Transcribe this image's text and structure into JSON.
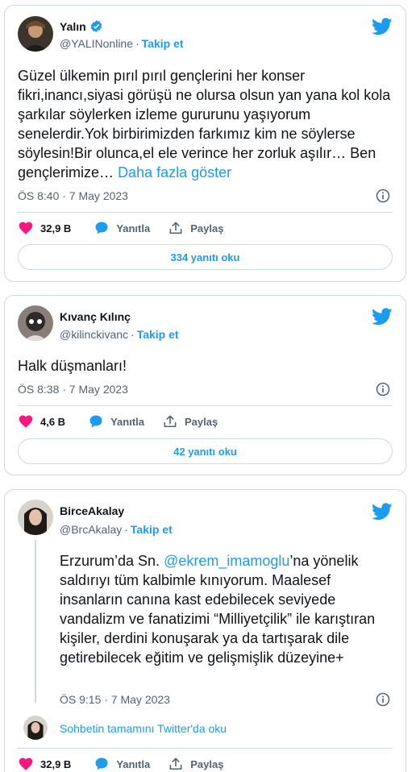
{
  "tweets": [
    {
      "name": "Yalın",
      "verified": true,
      "handle": "@YALINonline",
      "follow": "Takip et",
      "text": "Güzel ülkemin pırıl pırıl gençlerini her konser fikri,inancı,siyasi görüşü ne olursa olsun yan yana kol kola şarkılar söylerken izleme gururunu yaşıyorum senelerdir.Yok birbirimizden farkımız kim ne söylerse söylesin!Bir olunca,el ele verince her zorluk aşılır… Ben gençlerimize…",
      "more": "Daha fazla göster",
      "timestamp": "ÖS 8:40 · 7 May 2023",
      "likes": "32,9 B",
      "reply": "Yanıtla",
      "share": "Paylaş",
      "replies_button": "334 yanıtı oku"
    },
    {
      "name": "Kıvanç Kılınç",
      "handle": "@kilinckivanc",
      "follow": "Takip et",
      "text": "Halk düşmanları!",
      "timestamp": "ÖS 8:38 · 7 May 2023",
      "likes": "4,6 B",
      "reply": "Yanıtla",
      "share": "Paylaş",
      "replies_button": "42 yanıtı oku"
    },
    {
      "name": "BirceAkalay",
      "handle": "@BrcAkalay",
      "follow": "Takip et",
      "text_before": "Erzurum’da Sn. ",
      "mention": "@ekrem_imamoglu",
      "text_after": "’na yönelik saldırıyı tüm kalbimle kınıyorum. Maalesef insanların canına kast edebilecek seviyede vandalizm ve fanatizimi “Milliyetçilik” ile karıştıran kişiler, derdini konuşarak ya da tartışarak dile getirebilecek eğitim ve gelişmişlik düzeyine+",
      "timestamp": "ÖS 9:15 · 7 May 2023",
      "thread_link": "Sohbetin tamamını Twitter'da oku",
      "likes": "32,9 B",
      "reply": "Yanıtla",
      "share": "Paylaş"
    }
  ],
  "colors": {
    "accent": "#1d9bf0",
    "like": "#f91880",
    "muted": "#536471"
  }
}
